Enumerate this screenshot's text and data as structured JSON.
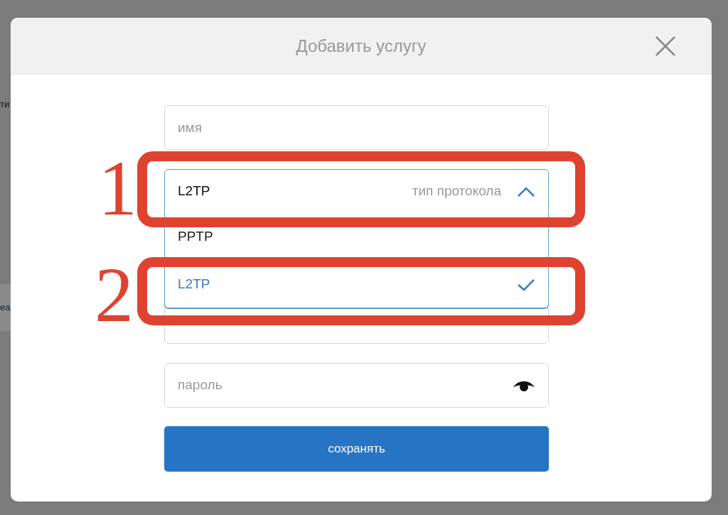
{
  "background": {
    "fragments": [
      {
        "kind": "label",
        "text": "ти"
      },
      {
        "kind": "link",
        "text": "ea"
      }
    ]
  },
  "dialog": {
    "title": "Добавить услугу",
    "fields": [
      {
        "kind": "text",
        "placeholder": "имя"
      },
      {
        "kind": "select",
        "value": "L2TP",
        "label": "тип протокола",
        "expanded": true,
        "options": [
          {
            "label": "PPTP",
            "selected": false
          },
          {
            "label": "L2TP",
            "selected": true
          }
        ]
      },
      {
        "kind": "blank"
      },
      {
        "kind": "password",
        "placeholder": "пароль"
      }
    ],
    "button": "сохранять"
  },
  "annotations": [
    {
      "number": "1"
    },
    {
      "number": "2"
    }
  ]
}
